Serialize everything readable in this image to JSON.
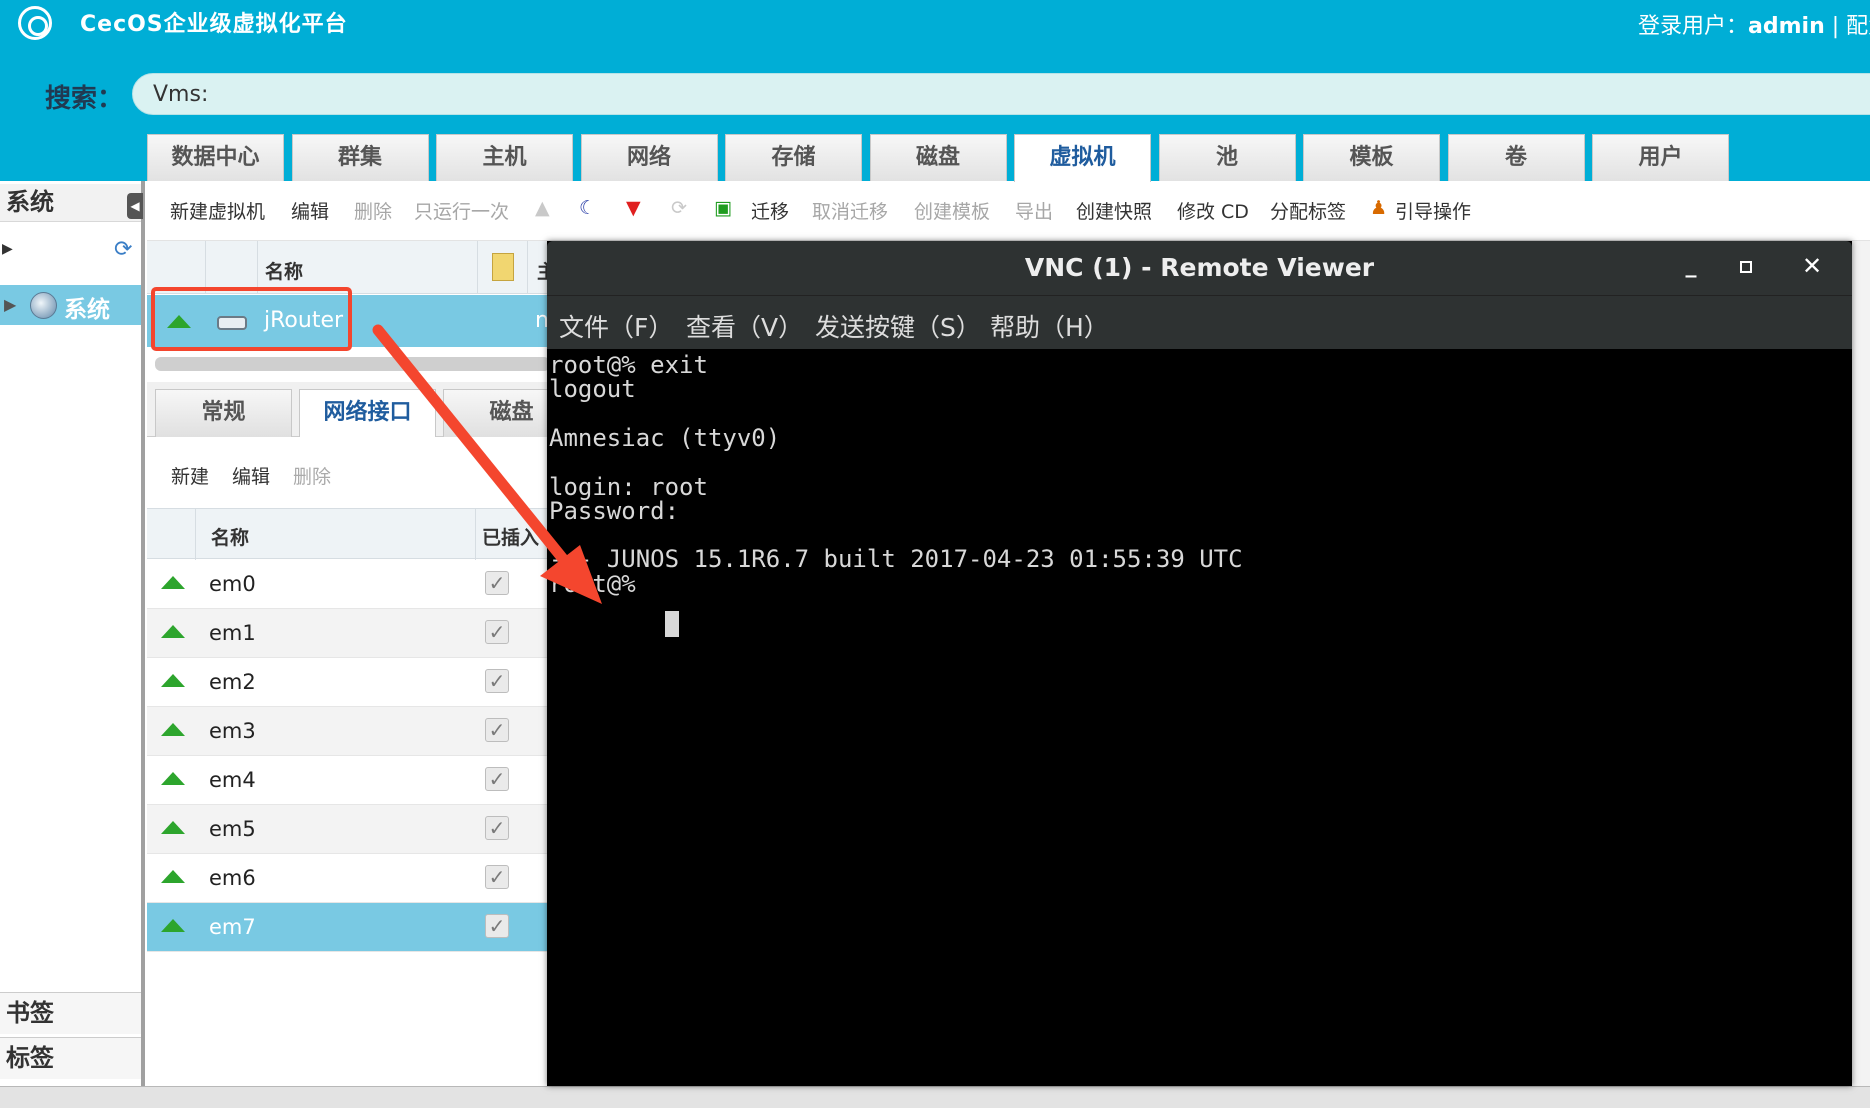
{
  "header": {
    "app_title": "CecOS企业级虚拟化平台",
    "user_label": "登录用户：",
    "user_name": "admin",
    "config_fragment": " | 配置"
  },
  "search": {
    "label": "搜索：",
    "value": "Vms:"
  },
  "main_tabs": [
    "数据中心",
    "群集",
    "主机",
    "网络",
    "存储",
    "磁盘",
    "虚拟机",
    "池",
    "模板",
    "卷",
    "用户"
  ],
  "active_main_tab": "虚拟机",
  "sidebar": {
    "title": "系统",
    "tree_item": "系统",
    "bookmarks": "书签",
    "tags": "标签"
  },
  "toolbar": {
    "new_vm": "新建虚拟机",
    "edit": "编辑",
    "delete": "删除",
    "run_once": "只运行一次",
    "migrate": "迁移",
    "cancel_migrate": "取消迁移",
    "create_template": "创建模板",
    "export": "导出",
    "create_snapshot": "创建快照",
    "change_cd": "修改 CD",
    "assign_tags": "分配标签",
    "guide": "引导操作"
  },
  "vm_grid": {
    "col_name": "名称",
    "col_extra": "主",
    "rows": [
      {
        "name": "jRouter",
        "extra": "n"
      }
    ]
  },
  "sub_tabs": [
    "常规",
    "网络接口",
    "磁盘"
  ],
  "active_sub_tab": "网络接口",
  "sub_toolbar": {
    "new": "新建",
    "edit": "编辑",
    "delete": "删除"
  },
  "nic_grid": {
    "col_name": "名称",
    "col_plugged": "已插入",
    "rows": [
      "em0",
      "em1",
      "em2",
      "em3",
      "em4",
      "em5",
      "em6",
      "em7"
    ],
    "selected": "em7"
  },
  "vnc": {
    "title": "VNC (1) - Remote Viewer",
    "menus": [
      "文件（F）",
      "查看（V）",
      "发送按键（S）",
      "帮助（H）"
    ],
    "terminal_lines": [
      "root@% exit",
      "logout",
      "",
      "Amnesiac (ttyv0)",
      "",
      "login: root",
      "Password:",
      "",
      "--- JUNOS 15.1R6.7 built 2017-04-23 01:55:39 UTC",
      "root@% "
    ]
  },
  "colors": {
    "header_bg": "#00aed6",
    "selection": "#79c9e3",
    "annotation_red": "#f4462e",
    "status_up": "#2da52d"
  }
}
